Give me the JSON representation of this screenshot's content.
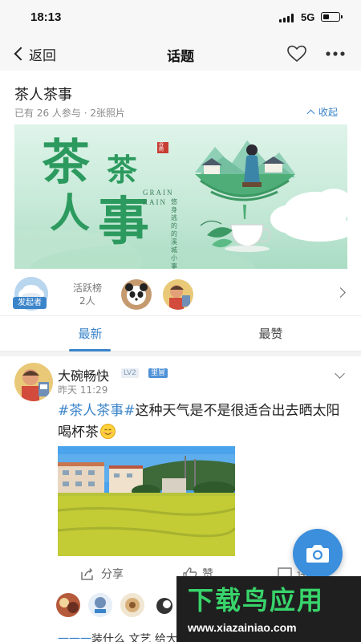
{
  "status_bar": {
    "time": "18:13",
    "network": "5G"
  },
  "nav": {
    "back_label": "返回",
    "title": "话题"
  },
  "topic": {
    "title": "茶人茶事",
    "meta": "已有 26 人参与 · 2张照片",
    "collapse_label": "收起"
  },
  "banner": {
    "big_chars": [
      "茶",
      "茶",
      "人",
      "事"
    ],
    "subtitle_line1": "GRAIN",
    "subtitle_line2": "RAIN",
    "seal_text": "谷雨",
    "vertical_text": "悠身逃的的溪城小事"
  },
  "participants": {
    "initiator_badge": "发起者",
    "leaderboard_label": "活跃榜",
    "leaderboard_count": "2人"
  },
  "tabs": [
    {
      "label": "最新",
      "active": true
    },
    {
      "label": "最赞",
      "active": false
    }
  ],
  "post": {
    "author": "大碗畅快",
    "level": "LV2",
    "region": "里冒",
    "time": "昨天 11:29",
    "hashtag": "#茶人茶事#",
    "text": "这种天气是不是很适合出去晒太阳喝杯茶",
    "actions": {
      "share": "分享",
      "like": "赞",
      "comment": "评论"
    }
  },
  "next_post_preview": {
    "dash": "一一一",
    "text": "装什么 文艺 给大家唱首歌吧"
  },
  "watermark": {
    "title": "下载鸟应用",
    "url": "www.xiazainiao.com"
  },
  "colors": {
    "accent": "#3a84c9",
    "fab": "#3b8fdc",
    "banner_green": "#2c9a5e",
    "watermark_green": "#38d46b"
  },
  "icons": [
    "heart-icon",
    "more-icon",
    "share-icon",
    "like-icon",
    "comment-icon",
    "camera-icon",
    "chevron-right-icon",
    "chevron-down-icon",
    "chevron-up-icon",
    "back-chevron-icon"
  ]
}
